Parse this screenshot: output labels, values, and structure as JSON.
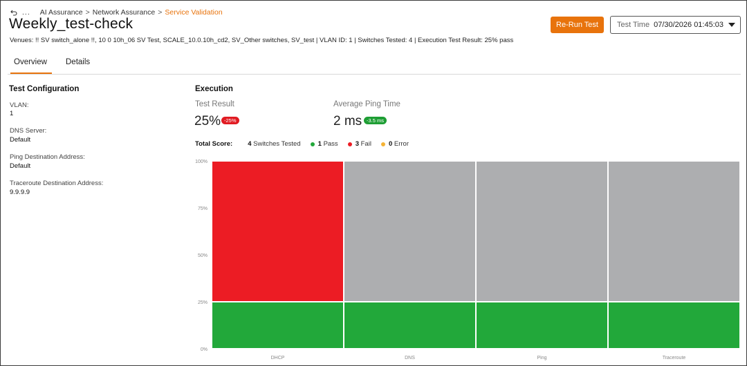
{
  "breadcrumb": {
    "ellipsis": "...",
    "items": [
      "AI Assurance",
      "Network Assurance",
      "Service Validation"
    ],
    "separator": ">"
  },
  "page": {
    "title": "Weekly_test-check",
    "subtitle": "Venues: !! SV switch_alone !!, 10 0 10h_06 SV Test, SCALE_10.0.10h_cd2, SV_Other switches, SV_test | VLAN ID: 1 | Switches Tested: 4 | Execution Test Result: 25% pass"
  },
  "actions": {
    "rerun_label": "Re-Run Test",
    "test_time_label": "Test Time",
    "test_time_value": "07/30/2026 01:45:03"
  },
  "tabs": [
    {
      "label": "Overview",
      "active": true
    },
    {
      "label": "Details",
      "active": false
    }
  ],
  "config": {
    "heading": "Test Configuration",
    "fields": [
      {
        "label": "VLAN:",
        "value": "1"
      },
      {
        "label": "DNS Server:",
        "value": "Default"
      },
      {
        "label": "Ping Destination Address:",
        "value": "Default"
      },
      {
        "label": "Traceroute Destination Address:",
        "value": "9.9.9.9"
      }
    ]
  },
  "execution": {
    "heading": "Execution",
    "test_result": {
      "label": "Test Result",
      "value": "25%",
      "delta": "-25%"
    },
    "avg_ping": {
      "label": "Average Ping Time",
      "value": "2 ms",
      "delta": "-3.5 ms"
    },
    "score": {
      "label": "Total Score:",
      "switches_count": "4",
      "switches_label": "Switches Tested",
      "pass_count": "1",
      "pass_label": "Pass",
      "fail_count": "3",
      "fail_label": "Fail",
      "error_count": "0",
      "error_label": "Error"
    }
  },
  "colors": {
    "accent": "#e8730c",
    "pass": "#22a83a",
    "fail": "#ec1c24",
    "error": "#f5b335",
    "neutral": "#adaeb0"
  },
  "chart_data": {
    "type": "bar",
    "stacked": true,
    "categories": [
      "DHCP",
      "DNS",
      "Ping",
      "Traceroute"
    ],
    "series": [
      {
        "key": "pass",
        "values": [
          25,
          25,
          25,
          25
        ]
      },
      {
        "key": "fail",
        "values": [
          75,
          0,
          0,
          0
        ]
      },
      {
        "key": "other",
        "values": [
          0,
          75,
          75,
          75
        ]
      }
    ],
    "yticks": [
      "0%",
      "25%",
      "50%",
      "75%",
      "100%"
    ],
    "ylim": [
      0,
      100
    ]
  }
}
